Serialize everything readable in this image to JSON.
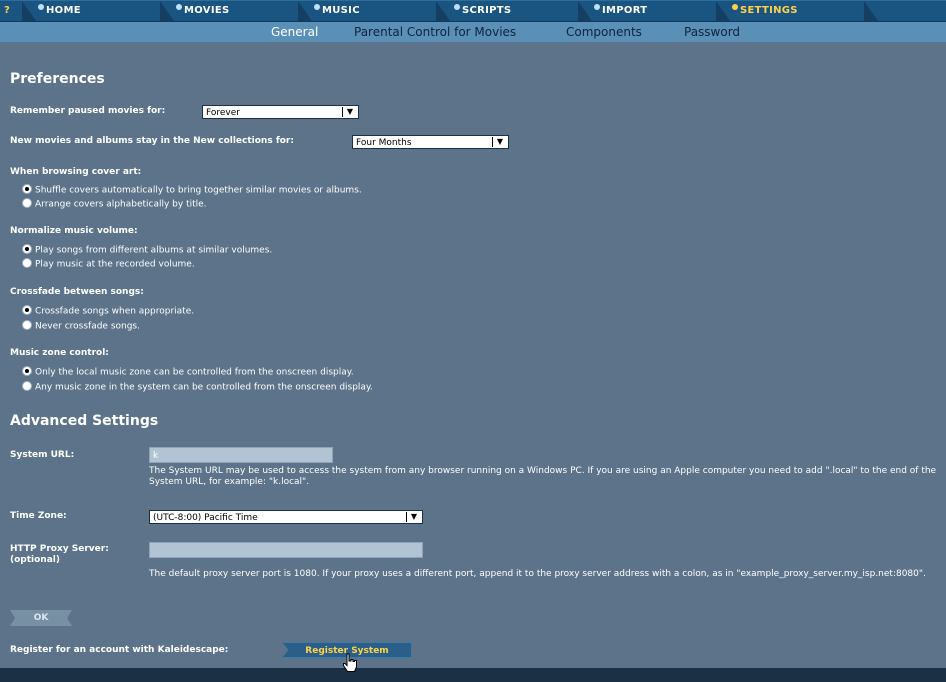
{
  "nav": {
    "help": "?",
    "tabs": [
      {
        "label": "HOME"
      },
      {
        "label": "MOVIES"
      },
      {
        "label": "MUSIC"
      },
      {
        "label": "SCRIPTS"
      },
      {
        "label": "IMPORT"
      },
      {
        "label": "SETTINGS",
        "active": true
      }
    ]
  },
  "subnav": {
    "tabs": [
      {
        "label": "General",
        "active": true
      },
      {
        "label": "Parental Control for Movies"
      },
      {
        "label": "Components"
      },
      {
        "label": "Password"
      }
    ]
  },
  "preferences": {
    "heading": "Preferences",
    "remember_paused": {
      "label": "Remember paused movies for:",
      "value": "Forever"
    },
    "new_collections": {
      "label": "New movies and albums stay in the New collections for:",
      "value": "Four Months"
    },
    "cover_art": {
      "label": "When browsing cover art:",
      "options": [
        {
          "label": "Shuffle covers automatically to bring together similar movies or albums.",
          "selected": true
        },
        {
          "label": "Arrange covers alphabetically by title.",
          "selected": false
        }
      ]
    },
    "normalize": {
      "label": "Normalize music volume:",
      "options": [
        {
          "label": "Play songs from different albums at similar volumes.",
          "selected": true
        },
        {
          "label": "Play music at the recorded volume.",
          "selected": false
        }
      ]
    },
    "crossfade": {
      "label": "Crossfade between songs:",
      "options": [
        {
          "label": "Crossfade songs when appropriate.",
          "selected": true
        },
        {
          "label": "Never crossfade songs.",
          "selected": false
        }
      ]
    },
    "zone": {
      "label": "Music zone control:",
      "options": [
        {
          "label": "Only the local music zone can be controlled from the onscreen display.",
          "selected": true
        },
        {
          "label": "Any music zone in the system can be controlled from the onscreen display.",
          "selected": false
        }
      ]
    }
  },
  "advanced": {
    "heading": "Advanced Settings",
    "system_url": {
      "label": "System URL:",
      "value": "k",
      "help": "The System URL may be used to access the system from any browser running on a Windows PC. If you are using an Apple computer you need to add \".local\" to the end of the System URL, for example: \"k.local\"."
    },
    "time_zone": {
      "label": "Time Zone:",
      "value": "(UTC-8:00) Pacific Time"
    },
    "proxy": {
      "label": "HTTP Proxy Server:",
      "label2": "(optional)",
      "value": "",
      "help": "The default proxy server port is 1080. If your proxy uses a different port, append it to the proxy server address with a colon, as in \"example_proxy_server.my_isp.net:8080\"."
    },
    "ok_label": "OK",
    "register_label": "Register for an account with Kaleidescape:",
    "register_button": "Register System"
  },
  "colors": {
    "accent": "#ffd24a",
    "nav": "#1a5480",
    "content": "#5c7389",
    "subnav": "#5a8fb8"
  }
}
